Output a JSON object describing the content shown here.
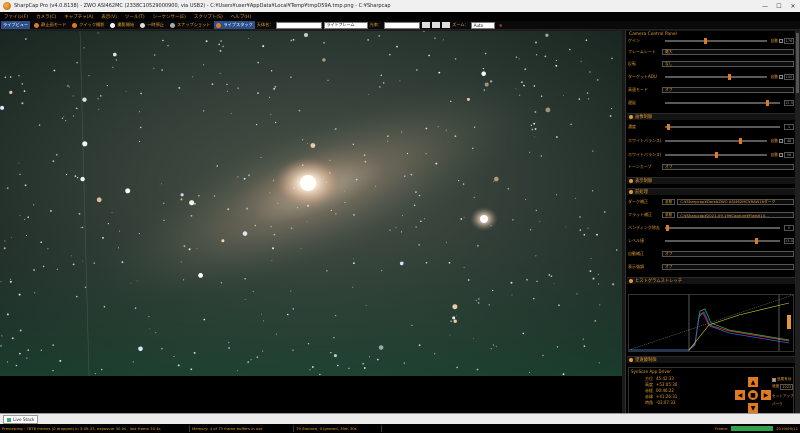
{
  "window": {
    "title": "SharpCap Pro (v4.0.8138) - ZWO ASI462MC (2338C10529000900, via USB2) - C:¥Users¥user¥AppData¥Local¥Temp¥tmpD59A.tmp.png - C:¥Sharpcap",
    "minimize": "—",
    "maximize": "☐",
    "close": "✕"
  },
  "menu": [
    "ファイル(F)",
    "カメラ(C)",
    "キャプチャ(A)",
    "表示(V)",
    "ツール(T)",
    "シーケンサー(E)",
    "スクリプト(S)",
    "ヘルプ(H)"
  ],
  "toolbar": {
    "live_view": "ライブビュー",
    "still_mode": "静止画モード",
    "quick_capture": "クイック撮影",
    "start_capture": "撮影開始",
    "stop": "一時停止",
    "snapshot": "スナップショット",
    "live_stack": "ライブスタック",
    "target_name_label": "天体名：",
    "target_name_value": "",
    "frame_select": "ライトフレーム",
    "focus_label": "光束：",
    "zoom_label": "ズーム：",
    "zoom_value": "Auto"
  },
  "camera_panel": {
    "title": "Camera Control Panel",
    "rows": [
      {
        "label": "ゲイン",
        "knob": 0.38,
        "auto": "自動",
        "value": "176"
      },
      {
        "label": "フレームレート",
        "select": "最大"
      },
      {
        "label": "反転",
        "select": "なし"
      },
      {
        "label": "ターゲットADU",
        "knob": 0.62,
        "auto": "自動",
        "value": "100"
      },
      {
        "label": "高速モード",
        "select": "オフ"
      },
      {
        "label": "遅延",
        "knob": 0.88,
        "auto": "",
        "value": "12.5"
      }
    ]
  },
  "image_section": {
    "title": "画像制御",
    "rows": [
      {
        "label": "濃度",
        "knob": 0.02,
        "value": "1"
      },
      {
        "label": "ホワイトバランス(赤)",
        "knob": 0.72,
        "auto": "自動",
        "value": "48"
      },
      {
        "label": "ホワイトバランス(青)",
        "knob": 0.49,
        "auto": "自動",
        "value": "56"
      },
      {
        "label": "トーンカーブ",
        "select": "オフ"
      }
    ]
  },
  "processing_section": {
    "title": "表示制御",
    "sub_title": "前処理",
    "dark_label": "ダーク補正",
    "dark_button": "参照",
    "dark_path": "C:¥Sharpcap¥Dark¥ZWO ASI462MC¥RAW16ダーク",
    "flat_label": "フラット補正",
    "flat_button": "参照",
    "flat_path": "C:¥Sharpcap¥2021-09-19¥Capture¥Flats¥10…",
    "banding_label": "バンディング除去",
    "banding_value": "0",
    "banding_knob": 0.01,
    "sharpen_label": "レベル値",
    "sharpen_value": "13.5",
    "sharpen_knob": 0.78,
    "auto_label": "自動補正",
    "auto_value": "オフ",
    "stretch_label": "表示強調",
    "stretch_value": "オフ"
  },
  "histogram": {
    "title": "ヒストグラムストレッチ"
  },
  "mount": {
    "title": "望遠鏡制御",
    "driver": "SynScan App Driver",
    "tracking_label": "追尾有効",
    "ra_label": "方位",
    "ra_value": "45:42:33",
    "alt_label": "高度",
    "alt_value": "+53:05:30",
    "dec_label": "赤経",
    "dec_value": "00:46:22",
    "decl_label": "赤緯",
    "decl_value": "+41:26:31",
    "ha_label": "時角",
    "ha_value": "-03:07:33",
    "speed_label": "速度",
    "speed_value": "1025",
    "park_label": "パーク",
    "setup_label": "セットアップ",
    "notes_label": "ノート"
  },
  "tabs": {
    "live_stack": "Live Stack"
  },
  "status": {
    "previewing": "Previewing : 7878 frames (0 dropped) in 3:09:33, exposure 30.0s , last frame 30.4s",
    "memory": "Memory: 4 of 73 frame buffers in use",
    "stacked": "79 Stacked, 0 Ignored, 39m 30s",
    "frames_label": "Frame:",
    "date": "2019/09/11"
  }
}
